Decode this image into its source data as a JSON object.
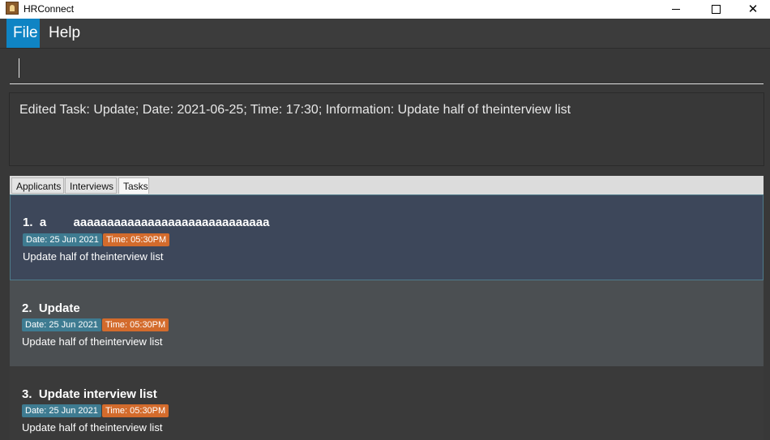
{
  "window": {
    "title": "HRConnect"
  },
  "menu": {
    "file": "File",
    "help": "Help"
  },
  "command": {
    "value": ""
  },
  "result": {
    "text": "Edited Task: Update; Date: 2021-06-25; Time: 17:30; Information: Update half of theinterview list"
  },
  "tabs": [
    {
      "label": "Applicants"
    },
    {
      "label": "Interviews"
    },
    {
      "label": "Tasks",
      "selected": true
    }
  ],
  "tasks": [
    {
      "title": "1.  a        aaaaaaaaaaaaaaaaaaaaaaaaaaaaa",
      "date": "Date: 25 Jun 2021",
      "time": "Time: 05:30PM",
      "info": "Update half of theinterview list"
    },
    {
      "title": "2.  Update",
      "date": "Date: 25 Jun 2021",
      "time": "Time: 05:30PM",
      "info": "Update half of theinterview list"
    },
    {
      "title": "3.  Update interview list",
      "date": "Date: 25 Jun 2021",
      "time": "Time: 05:30PM",
      "info": "Update half of theinterview list"
    }
  ],
  "colors": {
    "accent": "#0f84c4",
    "date_tag": "#3e7b91",
    "time_tag": "#d36b2c",
    "selected_card": "#3d475a"
  }
}
